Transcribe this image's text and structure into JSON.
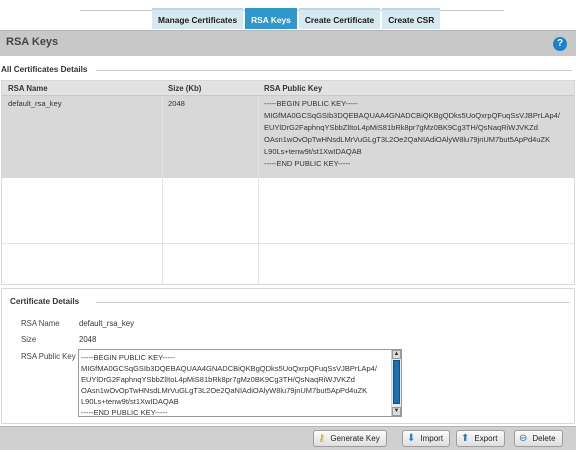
{
  "tabs": [
    {
      "label": "Manage Certificates",
      "active": false
    },
    {
      "label": "RSA Keys",
      "active": true
    },
    {
      "label": "Create Certificate",
      "active": false
    },
    {
      "label": "Create CSR",
      "active": false
    }
  ],
  "header": {
    "title": "RSA Keys",
    "help_glyph": "?"
  },
  "table": {
    "section_title": "All Certificates Details",
    "columns": [
      "RSA Name",
      "Size (Kb)",
      "RSA Public Key"
    ],
    "rows": [
      {
        "name": "default_rsa_key",
        "size": "2048",
        "public_key_lines": [
          "-----BEGIN PUBLIC KEY-----",
          "MIGfMA0GCSqGSIb3DQEBAQUAA4GNADCBiQKBgQDks5UoQxrpQFuqSsVJBPrLAp4/",
          "EUYlDrG2FaphnqYSbbZlItoL4pMiS81bRk8pr7gMz0BK9Cg3TH/QsNaqRiWJVKZd",
          "OAsn1wOvOpTwHNsdLMrVuGLgT3L2Oe2QaNIAdiOAlyW8lu79jnUM7but5ApPd4uZK",
          "L90Ls+tenw9t/st1XwIDAQAB",
          "-----END PUBLIC KEY-----"
        ]
      }
    ]
  },
  "details": {
    "section_title": "Certificate Details",
    "name_label": "RSA Name",
    "name_value": "default_rsa_key",
    "size_label": "Size",
    "size_value": "2048",
    "pk_label": "RSA Public Key",
    "pk_lines": [
      "-----BEGIN PUBLIC KEY-----",
      "MIGfMA0GCSqGSIb3DQEBAQUAA4GNADCBiQKBgQDks5UoQxrpQFuqSsVJBPrLAp4/",
      "EUYlDrG2FaphnqYSbbZlItoL4pMiS81bRk8pr7gMz0BK9Cg3TH/QsNaqRiWJVKZd",
      "OAsn1wOvOpTwHNsdLMrVuGLgT3L2Oe2QaNIAdiOAlyW8lu79jnUM7but5ApPd4uZK",
      "L90Ls+tenw9t/st1XwIDAQAB",
      "-----END PUBLIC KEY-----"
    ]
  },
  "footer": {
    "generate_label": "Generate Key",
    "import_label": "Import",
    "export_label": "Export",
    "delete_label": "Delete"
  },
  "colors": {
    "active_tab": "#2f97cb",
    "help_icon": "#1a82c8",
    "scroll_thumb": "#1c6fb3"
  }
}
